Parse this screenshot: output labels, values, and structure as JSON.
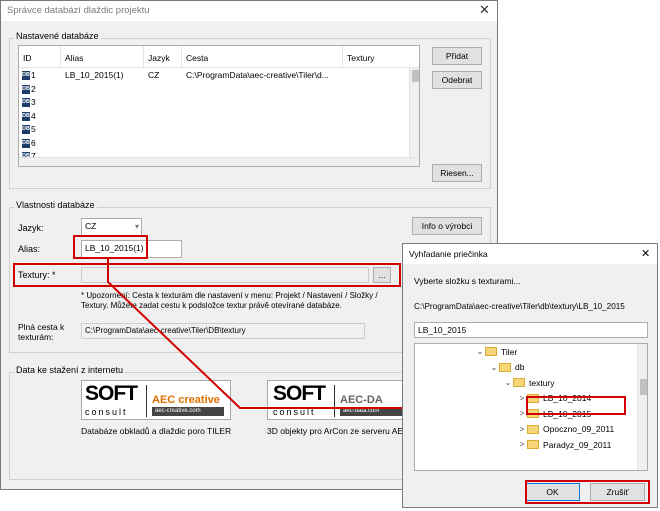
{
  "main_window": {
    "title": "Správce databází dlaždic projektu",
    "close_glyph": "✕",
    "configured_db": {
      "label": "Nastavené databáze",
      "columns": [
        "ID",
        "Alias",
        "Jazyk",
        "Cesta",
        "Textury"
      ],
      "rows": [
        {
          "id": "1",
          "alias": "LB_10_2015(1)",
          "lang": "CZ",
          "path": "C:\\ProgramData\\aec-creative\\Tiler\\d...",
          "tex": ""
        },
        {
          "id": "2",
          "alias": "",
          "lang": "",
          "path": "",
          "tex": ""
        },
        {
          "id": "3",
          "alias": "",
          "lang": "",
          "path": "",
          "tex": ""
        },
        {
          "id": "4",
          "alias": "",
          "lang": "",
          "path": "",
          "tex": ""
        },
        {
          "id": "5",
          "alias": "",
          "lang": "",
          "path": "",
          "tex": ""
        },
        {
          "id": "6",
          "alias": "",
          "lang": "",
          "path": "",
          "tex": ""
        },
        {
          "id": "7",
          "alias": "",
          "lang": "",
          "path": "",
          "tex": ""
        }
      ],
      "db_icon_text": "DB",
      "btn_add": "Přidat",
      "btn_remove": "Odebrat",
      "btn_refresh": "Riesen..."
    },
    "db_props": {
      "label": "Vlastnosti databáze",
      "lang_label": "Jazyk:",
      "lang_value": "CZ",
      "btn_info": "Info o výrobci",
      "alias_label": "Alias:",
      "alias_value": "LB_10_2015(1)",
      "textures_label": "Textury: *",
      "textures_value": "",
      "browse_btn": "...",
      "note": "* Upozornění: Cesta k texturám dle nastavení v menu: Projekt / Nastavení / Složky / Textury. Můžete zadat cestu k podsložce textur právě otevírané databáze.",
      "fullpath_label": "Plná cesta k texturám:",
      "fullpath_value": "C:\\ProgramData\\aec-creative\\Tiler\\DB\\textury"
    },
    "download": {
      "label": "Data ke stažení z internetu",
      "logo1_soft": "SOFT",
      "logo1_consult": "consult",
      "logo1_brand": "AEC creative",
      "logo1_url": "aec-creative.com",
      "logo1_caption": "Databáze obkladů a dlaždic poro TILER",
      "logo2_soft": "SOFT",
      "logo2_consult": "consult",
      "logo2_brand": "AEC-DA",
      "logo2_url": "aec-data.com",
      "logo2_caption": "3D objekty pro ArCon ze serveru AEC"
    }
  },
  "folder_dialog": {
    "title": "Vyhľadanie priečinka",
    "close_glyph": "✕",
    "prompt": "Vyberte složku s texturami...",
    "path": "C:\\ProgramData\\aec-creative\\Tiler\\db\\textury\\LB_10_2015",
    "name_value": "LB_10_2015",
    "tree": [
      {
        "label": "Tiler",
        "chev": "⌄",
        "indent": 0
      },
      {
        "label": "db",
        "chev": "⌄",
        "indent": 1
      },
      {
        "label": "textury",
        "chev": "⌄",
        "indent": 2
      },
      {
        "label": "LB_10_2014",
        "chev": ">",
        "indent": 3
      },
      {
        "label": "LB_10_2015",
        "chev": ">",
        "indent": 3
      },
      {
        "label": "Opoczno_09_2011",
        "chev": ">",
        "indent": 3
      },
      {
        "label": "Paradyz_09_2011",
        "chev": ">",
        "indent": 3
      }
    ],
    "btn_ok": "OK",
    "btn_cancel": "Zrušiť"
  },
  "colors": {
    "annotation_red": "#d00000",
    "db_icon": "#1c3c6c",
    "brand_orange": "#e07000"
  }
}
